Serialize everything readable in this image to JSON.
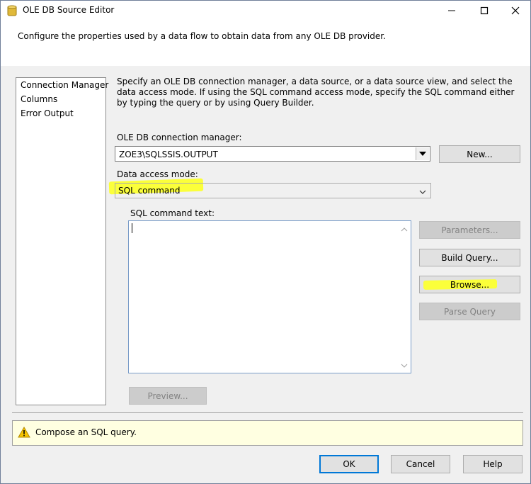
{
  "window": {
    "title": "OLE DB Source Editor",
    "controls": {
      "minimize": "minimize",
      "maximize": "maximize",
      "close": "close"
    }
  },
  "header": {
    "description": "Configure the properties used by a data flow to obtain data from any OLE DB provider."
  },
  "sidebar": {
    "items": [
      {
        "label": "Connection Manager"
      },
      {
        "label": "Columns"
      },
      {
        "label": "Error Output"
      }
    ]
  },
  "main": {
    "description": "Specify an OLE DB connection manager, a data source, or a data source view, and select the data access mode. If using the SQL command access mode, specify the SQL command either by typing the query or by using Query Builder.",
    "connection_manager": {
      "label": "OLE DB connection manager:",
      "value": "ZOE3\\SQLSSIS.OUTPUT",
      "new_button": "New..."
    },
    "access_mode": {
      "label": "Data access mode:",
      "value": "SQL command"
    },
    "sql_command": {
      "label": "SQL command text:",
      "value": ""
    },
    "buttons": {
      "parameters": "Parameters...",
      "build_query": "Build Query...",
      "browse": "Browse...",
      "parse_query": "Parse Query",
      "preview": "Preview..."
    }
  },
  "status": {
    "icon": "warning-icon",
    "message": "Compose an SQL query."
  },
  "footer": {
    "ok": "OK",
    "cancel": "Cancel",
    "help": "Help"
  },
  "colors": {
    "highlight": "#fbff3a",
    "status_background": "#ffffe1",
    "default_button_border": "#0078d7"
  }
}
